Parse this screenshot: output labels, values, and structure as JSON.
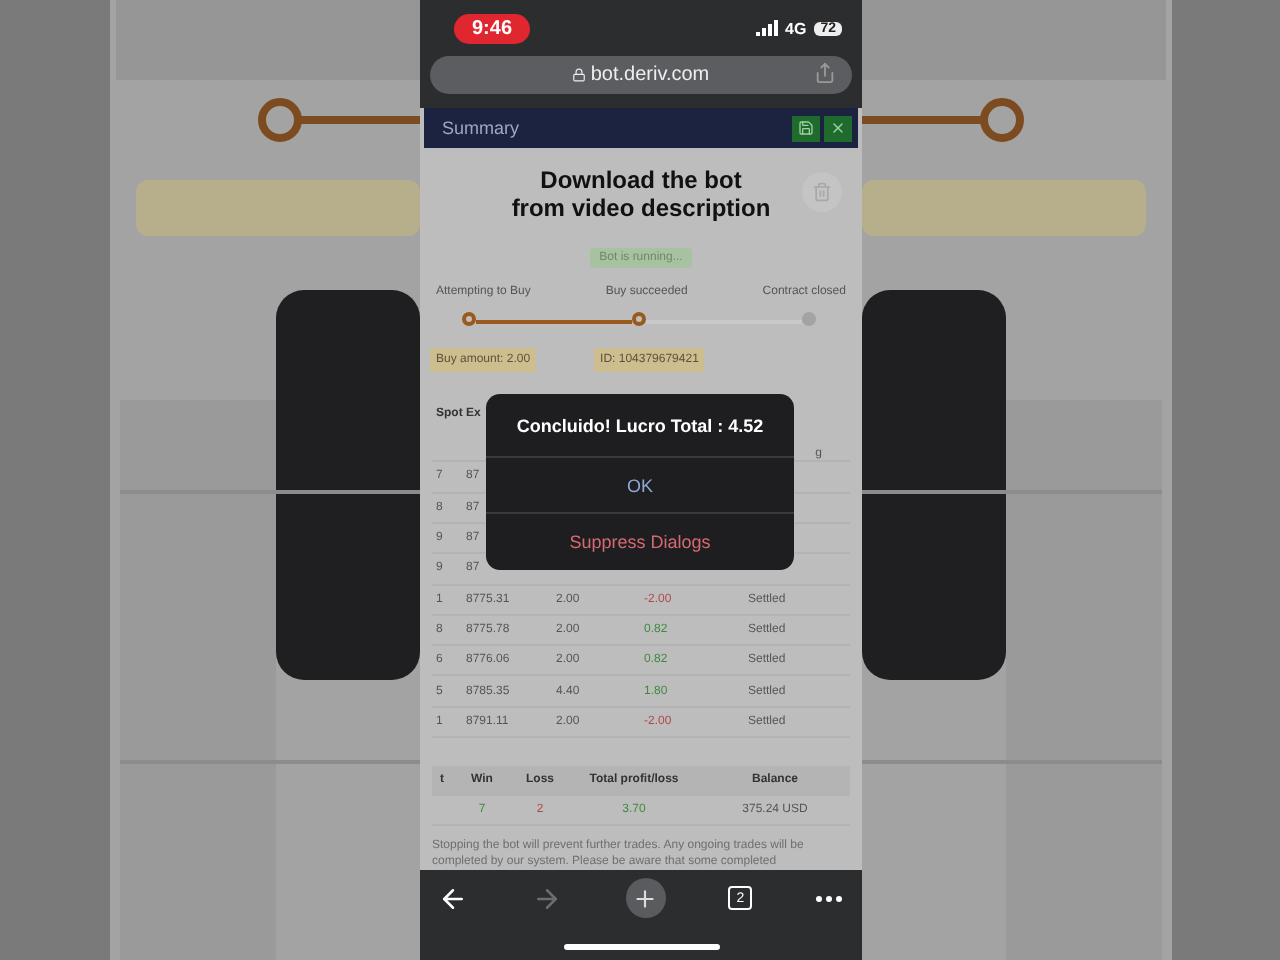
{
  "status_bar": {
    "time": "9:46",
    "network": "4G",
    "battery": "72"
  },
  "address_bar": {
    "url": "bot.deriv.com"
  },
  "panel": {
    "title": "Summary"
  },
  "overlay_caption": "Download the bot\nfrom video description",
  "status_badge": "Bot is running...",
  "steps": [
    {
      "label": "Attempting to Buy",
      "done": true
    },
    {
      "label": "Buy succeeded",
      "done": true
    },
    {
      "label": "Contract closed",
      "done": false
    }
  ],
  "buy_amount": "Buy amount: 2.00",
  "contract_id": "ID: 104379679421",
  "transactions": {
    "columns": [
      "Spot",
      "Ex"
    ],
    "corner_fragment": "g",
    "rows": [
      {
        "cells": [
          "7",
          "87"
        ]
      },
      {
        "cells": [
          "8",
          "87"
        ]
      },
      {
        "cells": [
          "9",
          "87"
        ]
      },
      {
        "cells": [
          "9",
          "87"
        ]
      },
      {
        "cells": [
          "1",
          "8775.31",
          "2.00",
          "-2.00",
          "Settled"
        ],
        "color": "#b04848"
      },
      {
        "cells": [
          "8",
          "8775.78",
          "2.00",
          "0.82",
          "Settled"
        ],
        "color": "#3d8a3d"
      },
      {
        "cells": [
          "6",
          "8776.06",
          "2.00",
          "0.82",
          "Settled"
        ],
        "color": "#3d8a3d"
      },
      {
        "cells": [
          "5",
          "8785.35",
          "4.40",
          "1.80",
          "Settled"
        ],
        "color": "#3d8a3d"
      },
      {
        "cells": [
          "1",
          "8791.11",
          "2.00",
          "-2.00",
          "Settled"
        ],
        "color": "#b04848"
      }
    ]
  },
  "totals": {
    "columns": [
      "t",
      "Win",
      "Loss",
      "Total profit/loss",
      "Balance"
    ],
    "values": [
      "7",
      "2",
      "3.70",
      "375.24 USD"
    ]
  },
  "notice": "Stopping the bot will prevent further trades. Any ongoing trades will be completed by our system. Please be aware that some completed",
  "dialog": {
    "message": "Concluido! Lucro Total : 4.52",
    "buttons": [
      {
        "label": "OK",
        "kind": "default"
      },
      {
        "label": "Suppress Dialogs",
        "kind": "destructive"
      }
    ]
  },
  "browser_toolbar": {
    "tab_count": "2",
    "forward_disabled": true
  }
}
